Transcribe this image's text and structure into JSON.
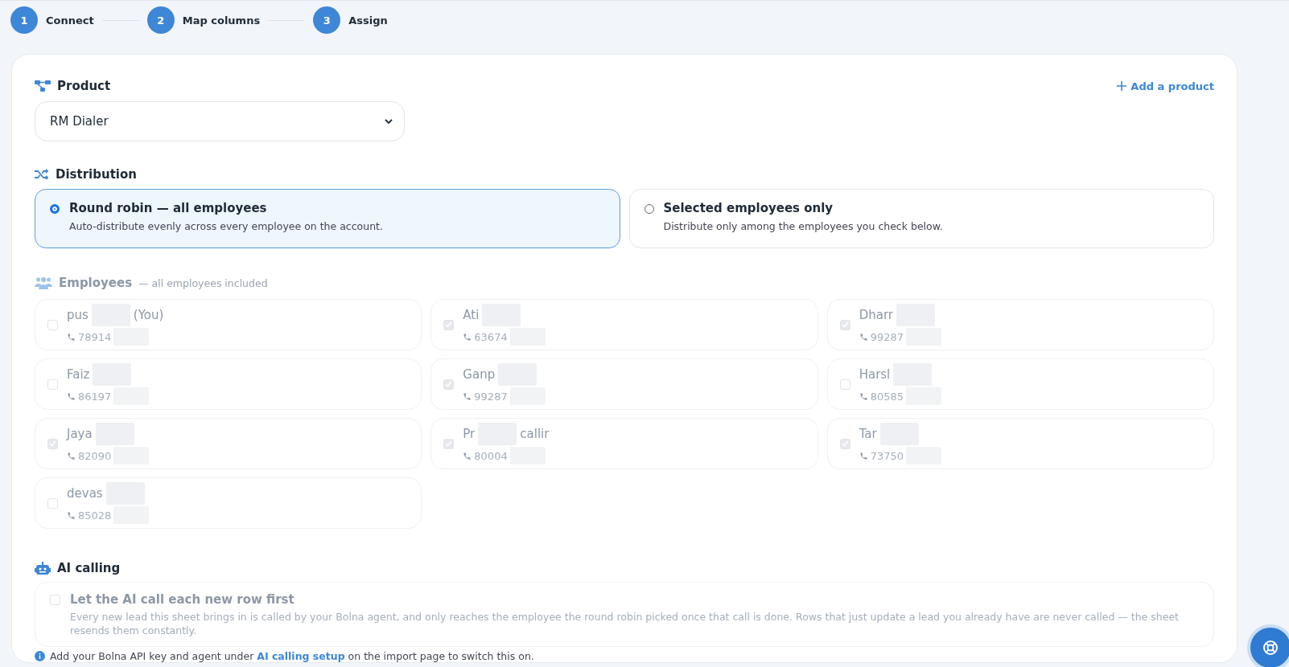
{
  "steps": [
    {
      "number": "1",
      "label": "Connect"
    },
    {
      "number": "2",
      "label": "Map columns"
    },
    {
      "number": "3",
      "label": "Assign"
    }
  ],
  "product": {
    "label": "Product",
    "add_link": "Add a product",
    "value": "RM Dialer"
  },
  "distribution": {
    "label": "Distribution",
    "options": [
      {
        "title": "Round robin — all employees",
        "description": "Auto-distribute evenly across every employee on the account.",
        "selected": true
      },
      {
        "title": "Selected employees only",
        "description": "Distribute only among the employees you check below.",
        "selected": false
      }
    ]
  },
  "employees": {
    "label": "Employees",
    "note": "— all employees included",
    "disabled": true,
    "items": [
      {
        "name": "pus",
        "name_suffix": "(You)",
        "phone": "78914",
        "checked": false
      },
      {
        "name": "Ati",
        "phone": "63674",
        "checked": true
      },
      {
        "name": "Dharr",
        "phone": "99287",
        "checked": true
      },
      {
        "name": "Faiz",
        "phone": "86197",
        "checked": false
      },
      {
        "name": "Ganp",
        "phone": "99287",
        "checked": true
      },
      {
        "name": "Harsl",
        "phone": "80585",
        "checked": false
      },
      {
        "name": "Jaya",
        "phone": "82090",
        "checked": true
      },
      {
        "name": "Pr",
        "name_suffix": "callir",
        "phone": "80004",
        "checked": true
      },
      {
        "name": "Tar",
        "phone": "73750",
        "checked": true
      },
      {
        "name": "devas",
        "phone": "85028",
        "checked": false
      }
    ]
  },
  "ai_calling": {
    "label": "AI calling",
    "option": {
      "title": "Let the AI call each new row first",
      "description": "Every new lead this sheet brings in is called by your Bolna agent, and only reaches the employee the round robin picked once that call is done. Rows that just update a lead you already have are never called — the sheet resends them constantly.",
      "checked": false,
      "disabled": true
    },
    "hint_before": "Add your Bolna API key and agent under",
    "hint_link": "AI calling setup",
    "hint_after": "on the import page to switch this on."
  }
}
